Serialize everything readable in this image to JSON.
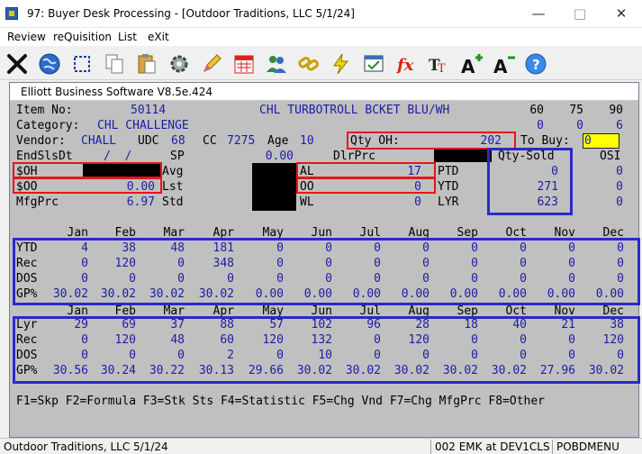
{
  "window": {
    "title": "97: Buyer Desk Processing - [Outdoor Traditions, LLC 5/1/24]"
  },
  "menu": [
    "Review",
    "reQuisition",
    "List",
    "eXit"
  ],
  "toolbar_icons": [
    "close-x-icon",
    "globe-icon",
    "selection-icon",
    "copy-icon",
    "paste-icon",
    "settings-gear-icon",
    "edit-pencil-icon",
    "calendar-icon",
    "users-icon",
    "link-chain-icon",
    "lightning-icon",
    "print-window-icon",
    "formula-fx-icon",
    "text-font-icon",
    "font-increase-icon",
    "font-decrease-icon",
    "help-icon"
  ],
  "inner_title": "Elliott Business Software V8.5e.424",
  "header": {
    "item_no_label": "Item No:",
    "item_no": "50114",
    "description": "CHL TURBOTROLL BCKET BLU/WH",
    "cols_days": [
      "60",
      "75",
      "90"
    ],
    "category_label": "Category:",
    "category": "CHL CHALLENGE",
    "days_vals_1": [
      "0",
      "0",
      "6"
    ],
    "vendor_label": "Vendor:",
    "vendor": "CHALL",
    "udc_label": "UDC",
    "udc": "68",
    "cc_label": "CC",
    "cc": "7275",
    "age_label": "Age",
    "age": "10",
    "qty_oh_label": "Qty OH:",
    "qty_oh": "202",
    "to_buy_label": "To Buy:",
    "to_buy": "0",
    "end_sls_dt_label": "EndSlsDt",
    "end_sls_dt": "/  /",
    "sp_label": "SP",
    "sp": "0.00",
    "dlr_prc_label": "DlrPrc",
    "qty_sold_label": "Qty-Sold",
    "osi_label": "OSI",
    "oh_dollar_label": "$OH",
    "avg_label": "Avg",
    "al_label": "AL",
    "al": "17",
    "ptd_label": "PTD",
    "ptd": "0",
    "osi_ptd": "0",
    "oo_dollar_label": "$OO",
    "oo_dollar": "0.00",
    "lst_label": "Lst",
    "oo_label": "OO",
    "oo": "0",
    "ytd_label": "YTD",
    "ytd": "271",
    "osi_ytd": "0",
    "mfg_prc_label": "MfgPrc",
    "mfg_prc": "6.97",
    "std_label": "Std",
    "wl_label": "WL",
    "wl": "0",
    "lyr_label": "LYR",
    "lyr": "623",
    "osi_lyr": "0"
  },
  "months": [
    "Jan",
    "Feb",
    "Mar",
    "Apr",
    "May",
    "Jun",
    "Jul",
    "Aug",
    "Sep",
    "Oct",
    "Nov",
    "Dec"
  ],
  "current_year": [
    {
      "label": "YTD",
      "values": [
        "4",
        "38",
        "48",
        "181",
        "0",
        "0",
        "0",
        "0",
        "0",
        "0",
        "0",
        "0"
      ]
    },
    {
      "label": "Rec",
      "values": [
        "0",
        "120",
        "0",
        "348",
        "0",
        "0",
        "0",
        "0",
        "0",
        "0",
        "0",
        "0"
      ]
    },
    {
      "label": "DOS",
      "values": [
        "0",
        "0",
        "0",
        "0",
        "0",
        "0",
        "0",
        "0",
        "0",
        "0",
        "0",
        "0"
      ]
    },
    {
      "label": "GP%",
      "values": [
        "30.02",
        "30.02",
        "30.02",
        "30.02",
        "0.00",
        "0.00",
        "0.00",
        "0.00",
        "0.00",
        "0.00",
        "0.00",
        "0.00"
      ]
    }
  ],
  "last_year": [
    {
      "label": "Lyr",
      "values": [
        "29",
        "69",
        "37",
        "88",
        "57",
        "102",
        "96",
        "28",
        "18",
        "40",
        "21",
        "38"
      ]
    },
    {
      "label": "Rec",
      "values": [
        "0",
        "120",
        "48",
        "60",
        "120",
        "132",
        "0",
        "120",
        "0",
        "0",
        "0",
        "120"
      ]
    },
    {
      "label": "DOS",
      "values": [
        "0",
        "0",
        "0",
        "2",
        "0",
        "10",
        "0",
        "0",
        "0",
        "0",
        "0",
        "0"
      ]
    },
    {
      "label": "GP%",
      "values": [
        "30.56",
        "30.24",
        "30.22",
        "30.13",
        "29.66",
        "30.02",
        "30.02",
        "30.02",
        "30.02",
        "30.02",
        "27.96",
        "30.02"
      ]
    }
  ],
  "function_keys": "F1=Skp F2=Formula F3=Stk Sts F4=Statistic F5=Chg Vnd F7=Chg MfgPrc F8=Other",
  "status": {
    "company": "Outdoor Traditions, LLC 5/1/24",
    "session": "002 EMK at DEV1CLS",
    "program": "POBDMENU"
  },
  "colors": {
    "screen_bg": "#c0c0c0",
    "value_text": "#1c1ca8",
    "highlight_red": "#e8141c",
    "highlight_blue": "#2a2ac8",
    "input_yellow": "#ffff00"
  }
}
